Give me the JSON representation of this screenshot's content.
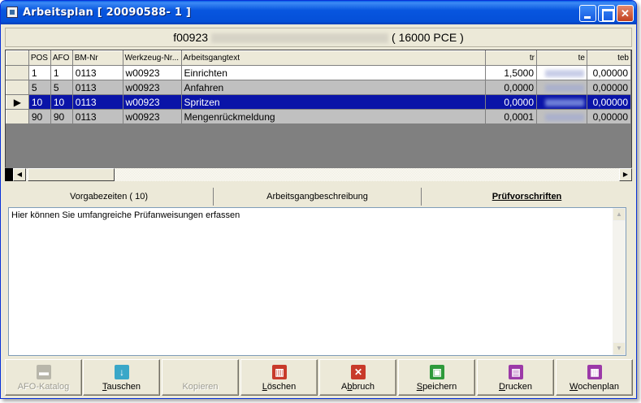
{
  "window": {
    "title": "Arbeitsplan  [ 20090588- 1 ]"
  },
  "header": {
    "article_no": "f00923",
    "quantity": "( 16000 PCE )"
  },
  "grid": {
    "columns": [
      "POS",
      "AFO",
      "BM-Nr",
      "Werkzeug-Nr...",
      "Arbeitsgangtext",
      "tr",
      "te",
      "teb"
    ],
    "rows": [
      {
        "pos": "1",
        "afo": "1",
        "bm": "0113",
        "tool": "w00923",
        "text": "Einrichten",
        "tr": "1,5000",
        "teb": "0,00000"
      },
      {
        "pos": "5",
        "afo": "5",
        "bm": "0113",
        "tool": "w00923",
        "text": "Anfahren",
        "tr": "0,0000",
        "teb": "0,00000"
      },
      {
        "pos": "10",
        "afo": "10",
        "bm": "0113",
        "tool": "w00923",
        "text": "Spritzen",
        "tr": "0,0000",
        "teb": "0,00000"
      },
      {
        "pos": "90",
        "afo": "90",
        "bm": "0113",
        "tool": "w00923",
        "text": "Mengenrückmeldung",
        "tr": "0,0001",
        "teb": "0,00000"
      }
    ]
  },
  "tabs": [
    {
      "label": "Vorgabezeiten ( 10)"
    },
    {
      "label": "Arbeitsgangbeschreibung"
    },
    {
      "label": "Prüfvorschriften"
    }
  ],
  "editor": {
    "text": "Hier können Sie umfangreiche Prüfanweisungen erfassen"
  },
  "toolbar": {
    "catalog": {
      "label": "AFO-Katalog",
      "color": "#9e9d92"
    },
    "swap": {
      "label_ul": "T",
      "label_rest": "auschen",
      "color": "#3aa7c8"
    },
    "copy": {
      "label": "Kopieren"
    },
    "delete": {
      "label_ul": "L",
      "label_rest": "öschen",
      "color": "#c83a2a"
    },
    "cancel": {
      "label_pre": "A",
      "label_ul": "b",
      "label_rest": "bruch",
      "color": "#c83a2a"
    },
    "save": {
      "label_ul": "S",
      "label_rest": "peichern",
      "color": "#2e9a3a"
    },
    "print": {
      "label_ul": "D",
      "label_rest": "rucken",
      "color": "#9c3aa8"
    },
    "weekplan": {
      "label_ul": "W",
      "label_rest": "ochenplan",
      "color": "#9c3aa8"
    }
  }
}
